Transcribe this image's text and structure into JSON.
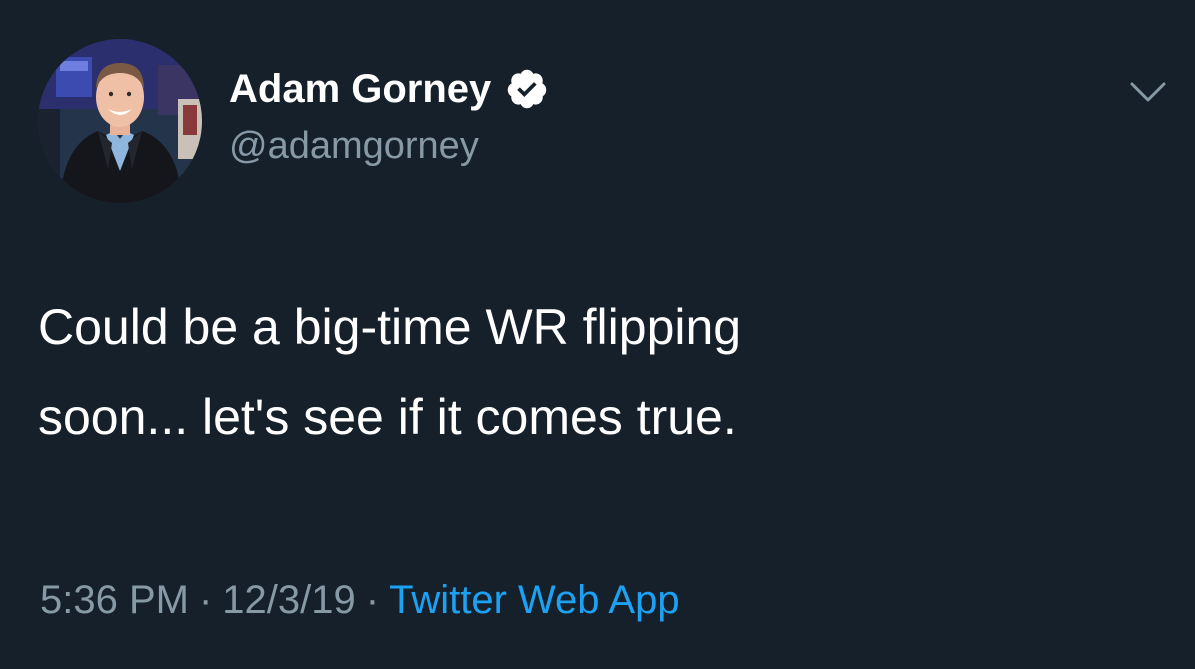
{
  "theme": {
    "background": "#15202b",
    "text_primary": "#ffffff",
    "text_secondary": "#8899a6",
    "link": "#1da1f2",
    "verified_badge": "#ffffff"
  },
  "author": {
    "display_name": "Adam Gorney",
    "handle": "@adamgorney",
    "verified": true,
    "avatar_icon": "profile-photo"
  },
  "tweet": {
    "text": "Could be a big-time WR flipping\nsoon... let's see if it comes true."
  },
  "meta": {
    "time": "5:36 PM",
    "separator": "·",
    "date": "12/3/19",
    "source": "Twitter Web App"
  },
  "icons": {
    "more": "chevron-down-icon",
    "verified": "verified-badge-icon"
  }
}
